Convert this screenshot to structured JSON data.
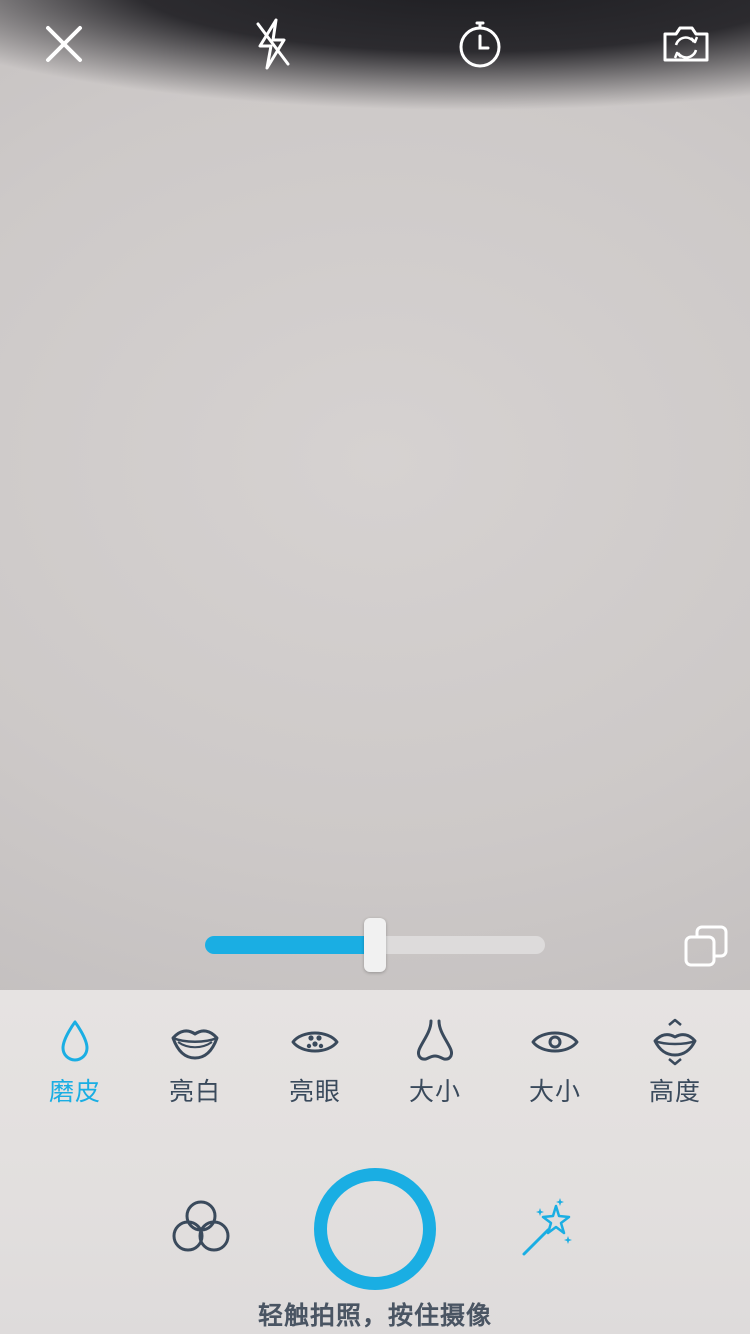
{
  "camera": {
    "close_icon": "close-icon",
    "flash_icon": "flash-off-icon",
    "timer_icon": "timer-icon",
    "switch_camera_icon": "camera-switch-icon"
  },
  "beauty_slider": {
    "value_fraction": 0.5,
    "accent_color": "#1aaee3"
  },
  "compare_icon": "compare-icon",
  "tools": [
    {
      "label": "磨皮",
      "icon": "droplet-icon",
      "active": true
    },
    {
      "label": "亮白",
      "icon": "lips-icon",
      "active": false
    },
    {
      "label": "亮眼",
      "icon": "eye-sparkle-icon",
      "active": false
    },
    {
      "label": "大小",
      "icon": "nose-icon",
      "active": false
    },
    {
      "label": "大小",
      "icon": "eye-icon",
      "active": false
    },
    {
      "label": "高度",
      "icon": "lips-height-icon",
      "active": false
    }
  ],
  "bottom_bar": {
    "filters_icon": "filters-icon",
    "magic_icon": "magic-wand-icon",
    "hint": "轻触拍照，按住摄像"
  },
  "colors": {
    "accent": "#1aaee3",
    "icon_dark": "#3a4a5c",
    "icon_light": "#ffffff"
  }
}
